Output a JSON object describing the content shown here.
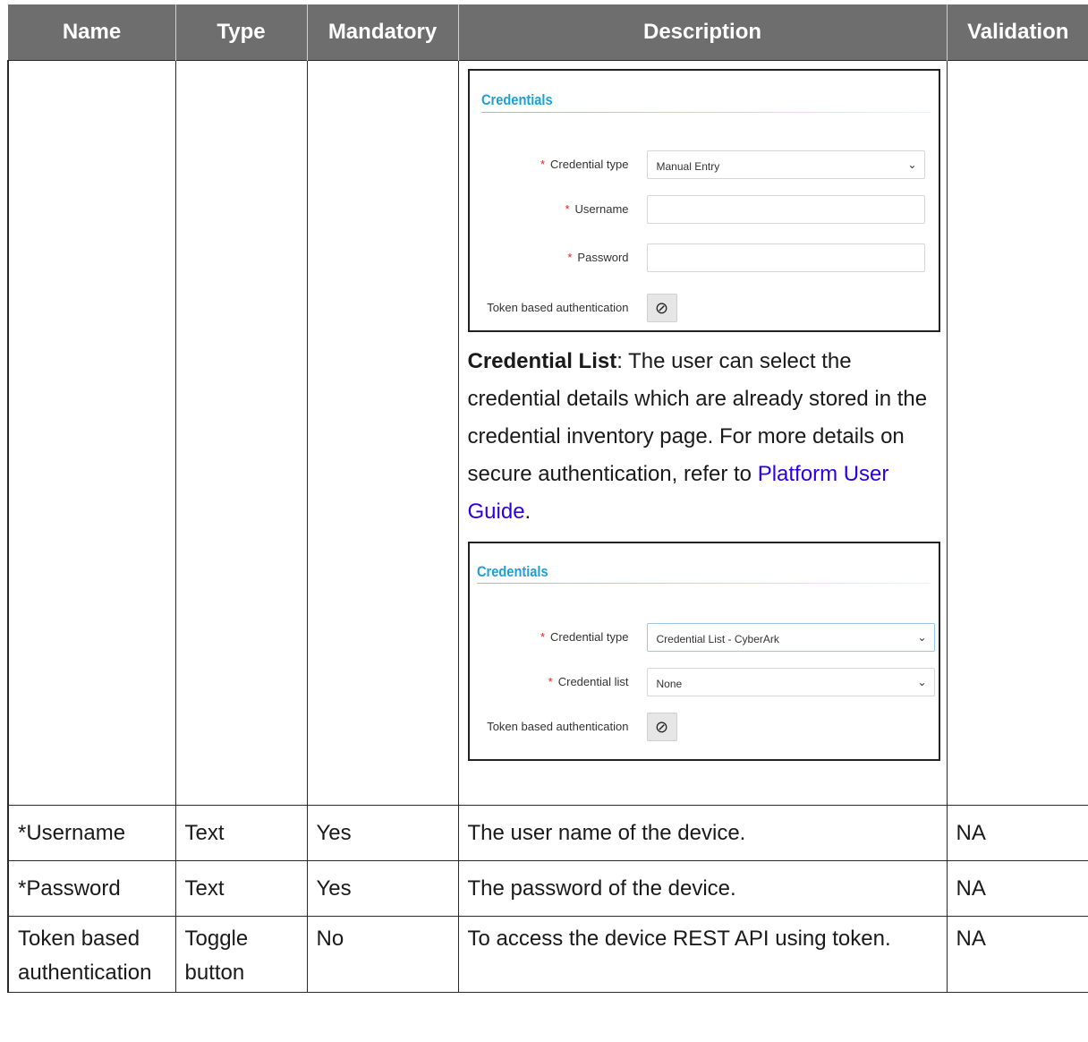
{
  "table": {
    "headers": [
      "Name",
      "Type",
      "Mandatory",
      "Description",
      "Validation"
    ],
    "row0": {
      "shot1": {
        "title": "Credentials",
        "fields": [
          {
            "label": "Credential type",
            "required": "*",
            "value": "Manual Entry",
            "kind": "select"
          },
          {
            "label": "Username",
            "required": "*",
            "value": "",
            "kind": "text"
          },
          {
            "label": "Password",
            "required": "*",
            "value": "",
            "kind": "text"
          },
          {
            "label": "Token based authentication",
            "required": "",
            "value": "⊘",
            "kind": "toggle"
          }
        ]
      },
      "para_bold": "Credential List",
      "para_text": ": The user can select the credential details which are already stored in the credential inventory page. For more details on secure authentication, refer to",
      "link_text": "Platform User Guide",
      "link_after": ".",
      "shot2": {
        "title": "Credentials",
        "fields": [
          {
            "label": "Credential type",
            "required": "*",
            "value": "Credential List - CyberArk",
            "kind": "select"
          },
          {
            "label": "Credential list",
            "required": "*",
            "value": "None",
            "kind": "select"
          },
          {
            "label": "Token based authentication",
            "required": "",
            "value": "⊘",
            "kind": "toggle"
          }
        ]
      }
    },
    "rows": [
      {
        "name": "*Username",
        "type": "Text",
        "mandatory": "Yes",
        "description": "The user name of the device.",
        "validation": "NA"
      },
      {
        "name": "*Password",
        "type": "Text",
        "mandatory": "Yes",
        "description": "The password of the device.",
        "validation": "NA"
      },
      {
        "name": "Token based authentication",
        "type": "Toggle button",
        "mandatory": "No",
        "description": "To access the device REST API using token.",
        "validation": "NA"
      }
    ]
  },
  "colors": {
    "header_bg": "#6e6e6e",
    "title_blue": "#1ea0d5",
    "link": "#2b00e6",
    "required": "#e0201a"
  }
}
